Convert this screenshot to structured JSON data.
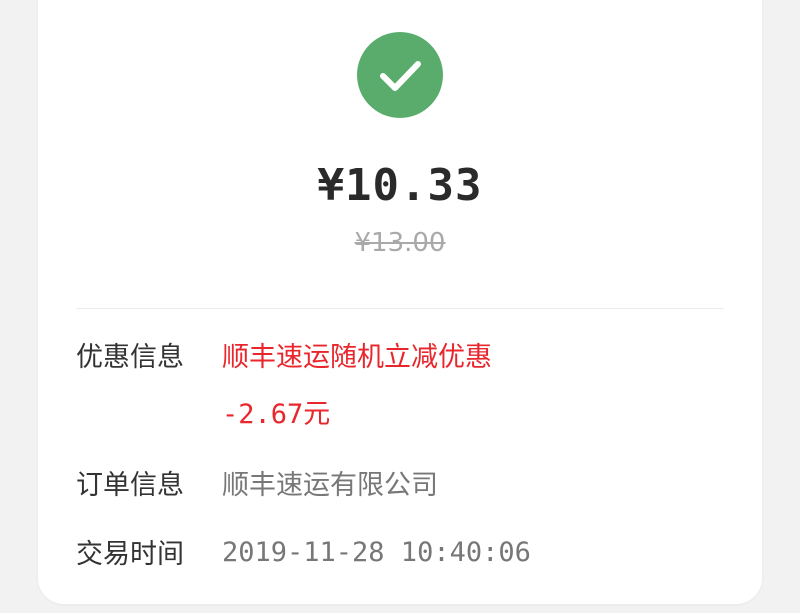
{
  "icons": {
    "success": "check-icon"
  },
  "colors": {
    "success_green": "#5aac6c",
    "discount_red": "#e8262c"
  },
  "payment": {
    "amount": "¥10.33",
    "original_amount": "¥13.00"
  },
  "details": {
    "discount": {
      "label": "优惠信息",
      "value": "顺丰速运随机立减优惠",
      "amount": "-2.67元"
    },
    "order": {
      "label": "订单信息",
      "value": "顺丰速运有限公司"
    },
    "time": {
      "label": "交易时间",
      "value": "2019-11-28 10:40:06"
    }
  }
}
